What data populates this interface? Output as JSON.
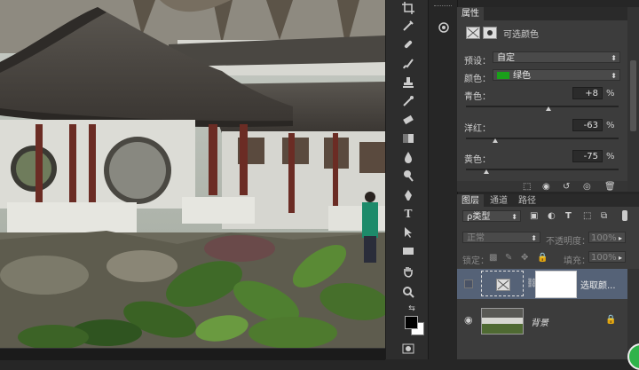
{
  "properties_panel": {
    "tab_label": "属性",
    "adjustment_title": "可选颜色",
    "preset_label": "预设：",
    "preset_value": "自定",
    "colors_label": "颜色：",
    "colors_value": "绿色",
    "colors_swatch": "#1aa01a",
    "sliders": [
      {
        "label": "青色：",
        "value": "+8",
        "unit": "%",
        "level": 0.54
      },
      {
        "label": "洋红：",
        "value": "-63",
        "unit": "%",
        "level": 0.19
      },
      {
        "label": "黄色：",
        "value": "-75",
        "unit": "%",
        "level": 0.13
      }
    ]
  },
  "layers_panel": {
    "tabs": [
      "图层",
      "通道",
      "路径"
    ],
    "filter_label": "ρ类型",
    "blend_mode": "正常",
    "opacity_label": "不透明度：",
    "opacity_value": "100%",
    "lock_label": "锁定：",
    "fill_label": "填充：",
    "fill_value": "100%",
    "layers": [
      {
        "name": "选取颜...",
        "visible": false,
        "selected": true
      },
      {
        "name": "背景",
        "visible": true,
        "selected": false
      }
    ]
  },
  "colors": {
    "panel_bg": "#3c3c3c",
    "selected_row": "#556277",
    "foreground": "#000000",
    "background": "#ffffff"
  }
}
